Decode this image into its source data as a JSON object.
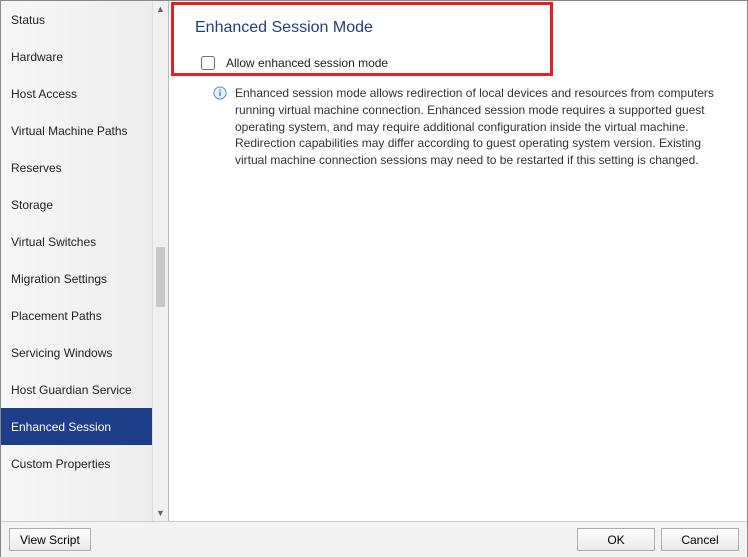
{
  "sidebar": {
    "items": [
      {
        "label": "Status"
      },
      {
        "label": "Hardware"
      },
      {
        "label": "Host Access"
      },
      {
        "label": "Virtual Machine Paths"
      },
      {
        "label": "Reserves"
      },
      {
        "label": "Storage"
      },
      {
        "label": "Virtual Switches"
      },
      {
        "label": "Migration Settings"
      },
      {
        "label": "Placement Paths"
      },
      {
        "label": "Servicing Windows"
      },
      {
        "label": "Host Guardian Service"
      },
      {
        "label": "Enhanced Session"
      },
      {
        "label": "Custom Properties"
      }
    ],
    "selected_index": 11
  },
  "content": {
    "heading": "Enhanced Session Mode",
    "checkbox_label": "Allow enhanced session mode",
    "checkbox_checked": false,
    "info_text": "Enhanced session mode allows redirection of local devices and resources from computers running virtual machine connection. Enhanced session mode requires a supported guest operating system, and may require additional configuration inside the virtual machine. Redirection capabilities may differ according to guest operating system version. Existing virtual machine connection sessions may need to be restarted if this setting is changed."
  },
  "footer": {
    "view_script": "View Script",
    "ok": "OK",
    "cancel": "Cancel"
  }
}
